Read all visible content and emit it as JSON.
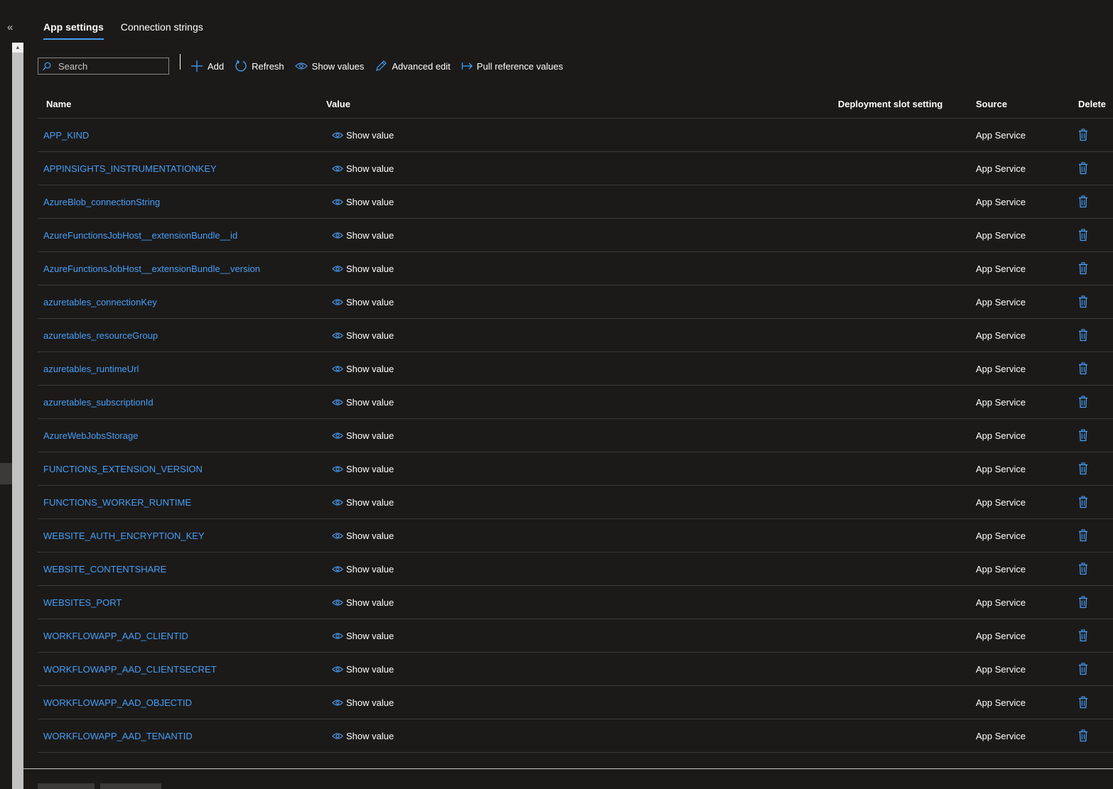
{
  "nav": {
    "collapse_glyph": "«"
  },
  "tabs": [
    {
      "label": "App settings",
      "active": true
    },
    {
      "label": "Connection strings",
      "active": false
    }
  ],
  "toolbar": {
    "search_placeholder": "Search",
    "add_label": "Add",
    "refresh_label": "Refresh",
    "show_values_label": "Show values",
    "advanced_edit_label": "Advanced edit",
    "pull_reference_label": "Pull reference values"
  },
  "table": {
    "headers": {
      "name": "Name",
      "value": "Value",
      "slot": "Deployment slot setting",
      "source": "Source",
      "delete": "Delete"
    },
    "rows": [
      {
        "name": "APP_KIND",
        "value": "Show value",
        "source": "App Service"
      },
      {
        "name": "APPINSIGHTS_INSTRUMENTATIONKEY",
        "value": "Show value",
        "source": "App Service"
      },
      {
        "name": "AzureBlob_connectionString",
        "value": "Show value",
        "source": "App Service"
      },
      {
        "name": "AzureFunctionsJobHost__extensionBundle__id",
        "value": "Show value",
        "source": "App Service"
      },
      {
        "name": "AzureFunctionsJobHost__extensionBundle__version",
        "value": "Show value",
        "source": "App Service"
      },
      {
        "name": "azuretables_connectionKey",
        "value": "Show value",
        "source": "App Service"
      },
      {
        "name": "azuretables_resourceGroup",
        "value": "Show value",
        "source": "App Service"
      },
      {
        "name": "azuretables_runtimeUrl",
        "value": "Show value",
        "source": "App Service"
      },
      {
        "name": "azuretables_subscriptionId",
        "value": "Show value",
        "source": "App Service"
      },
      {
        "name": "AzureWebJobsStorage",
        "value": "Show value",
        "source": "App Service"
      },
      {
        "name": "FUNCTIONS_EXTENSION_VERSION",
        "value": "Show value",
        "source": "App Service"
      },
      {
        "name": "FUNCTIONS_WORKER_RUNTIME",
        "value": "Show value",
        "source": "App Service"
      },
      {
        "name": "WEBSITE_AUTH_ENCRYPTION_KEY",
        "value": "Show value",
        "source": "App Service"
      },
      {
        "name": "WEBSITE_CONTENTSHARE",
        "value": "Show value",
        "source": "App Service"
      },
      {
        "name": "WEBSITES_PORT",
        "value": "Show value",
        "source": "App Service"
      },
      {
        "name": "WORKFLOWAPP_AAD_CLIENTID",
        "value": "Show value",
        "source": "App Service"
      },
      {
        "name": "WORKFLOWAPP_AAD_CLIENTSECRET",
        "value": "Show value",
        "source": "App Service"
      },
      {
        "name": "WORKFLOWAPP_AAD_OBJECTID",
        "value": "Show value",
        "source": "App Service"
      },
      {
        "name": "WORKFLOWAPP_AAD_TENANTID",
        "value": "Show value",
        "source": "App Service"
      }
    ]
  },
  "colors": {
    "background": "#1b1a19",
    "accent": "#479ef5",
    "text": "#ffffff",
    "divider": "#3b3a39"
  },
  "icons": {
    "search": "search-icon",
    "add": "plus-icon",
    "refresh": "refresh-icon",
    "show": "eye-icon",
    "edit": "pencil-icon",
    "pull": "pull-reference-icon",
    "delete": "trash-icon",
    "collapse": "double-chevron-left-icon"
  }
}
